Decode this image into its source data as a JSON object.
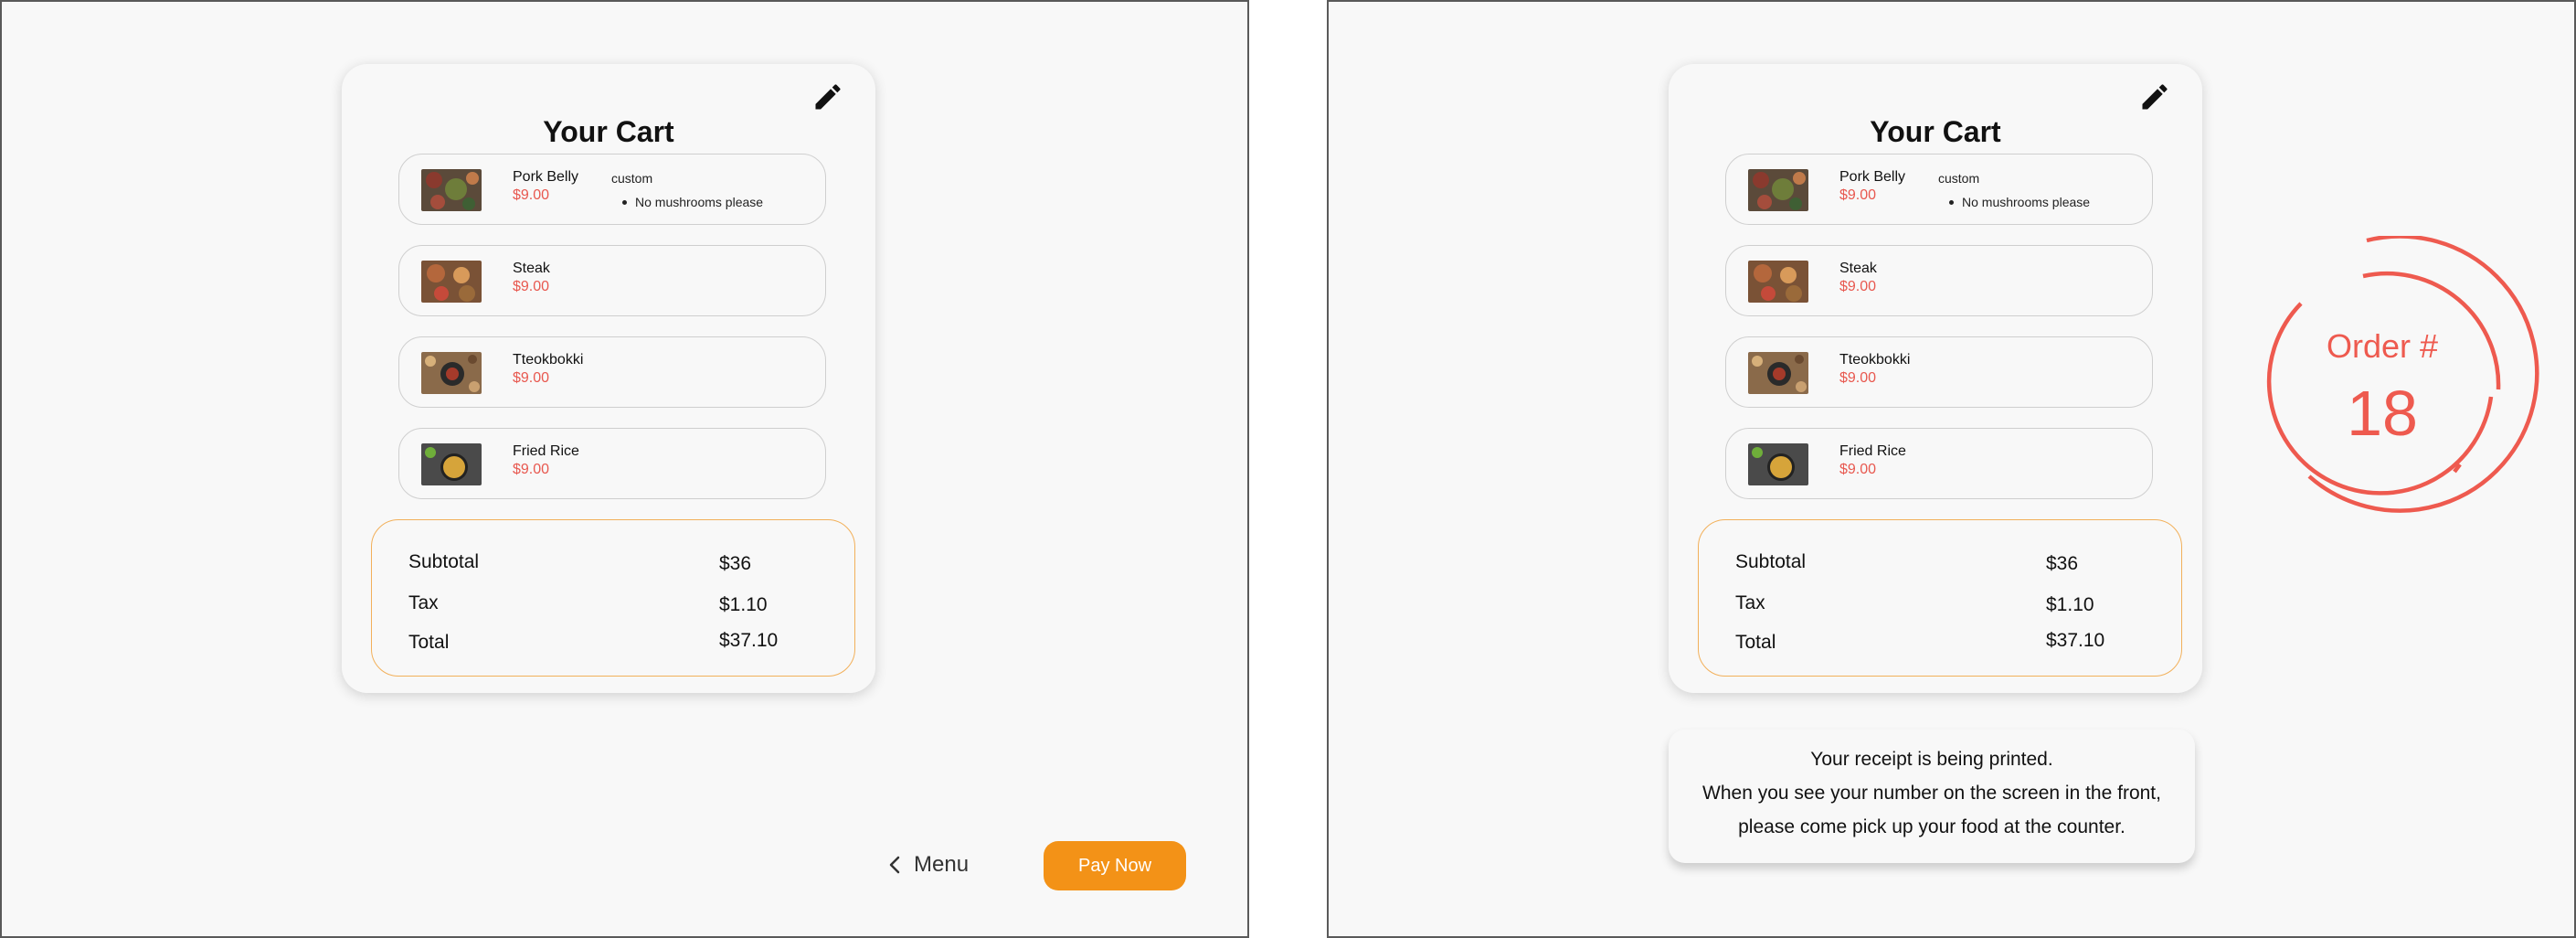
{
  "cart": {
    "title": "Your Cart",
    "items": [
      {
        "name": "Pork Belly",
        "price": "$9.00",
        "custom_label": "custom",
        "note": "No mushrooms please",
        "image": "pork-belly-photo"
      },
      {
        "name": "Steak",
        "price": "$9.00",
        "image": "steak-photo"
      },
      {
        "name": "Tteokbokki",
        "price": "$9.00",
        "image": "tteokbokki-photo"
      },
      {
        "name": "Fried Rice",
        "price": "$9.00",
        "image": "fried-rice-photo"
      }
    ],
    "summary": {
      "subtotal_label": "Subtotal",
      "subtotal_value": "$36",
      "tax_label": "Tax",
      "tax_value": "$1.10",
      "total_label": "Total",
      "total_value": "$37.10"
    }
  },
  "left_screen": {
    "menu_label": "Menu",
    "pay_label": "Pay Now"
  },
  "right_screen": {
    "receipt_line1": "Your receipt is being printed.",
    "receipt_line2": "When you see your number on the screen in the front,",
    "receipt_line3": "please come pick up your food at the counter.",
    "order_label": "Order #",
    "order_number": "18"
  },
  "icons": {
    "edit": "pencil-icon",
    "back": "chevron-left-icon"
  },
  "colors": {
    "price": "#e8584f",
    "accent": "#f39217",
    "summary_border": "#f2b05a",
    "order": "#ee5a4f"
  }
}
